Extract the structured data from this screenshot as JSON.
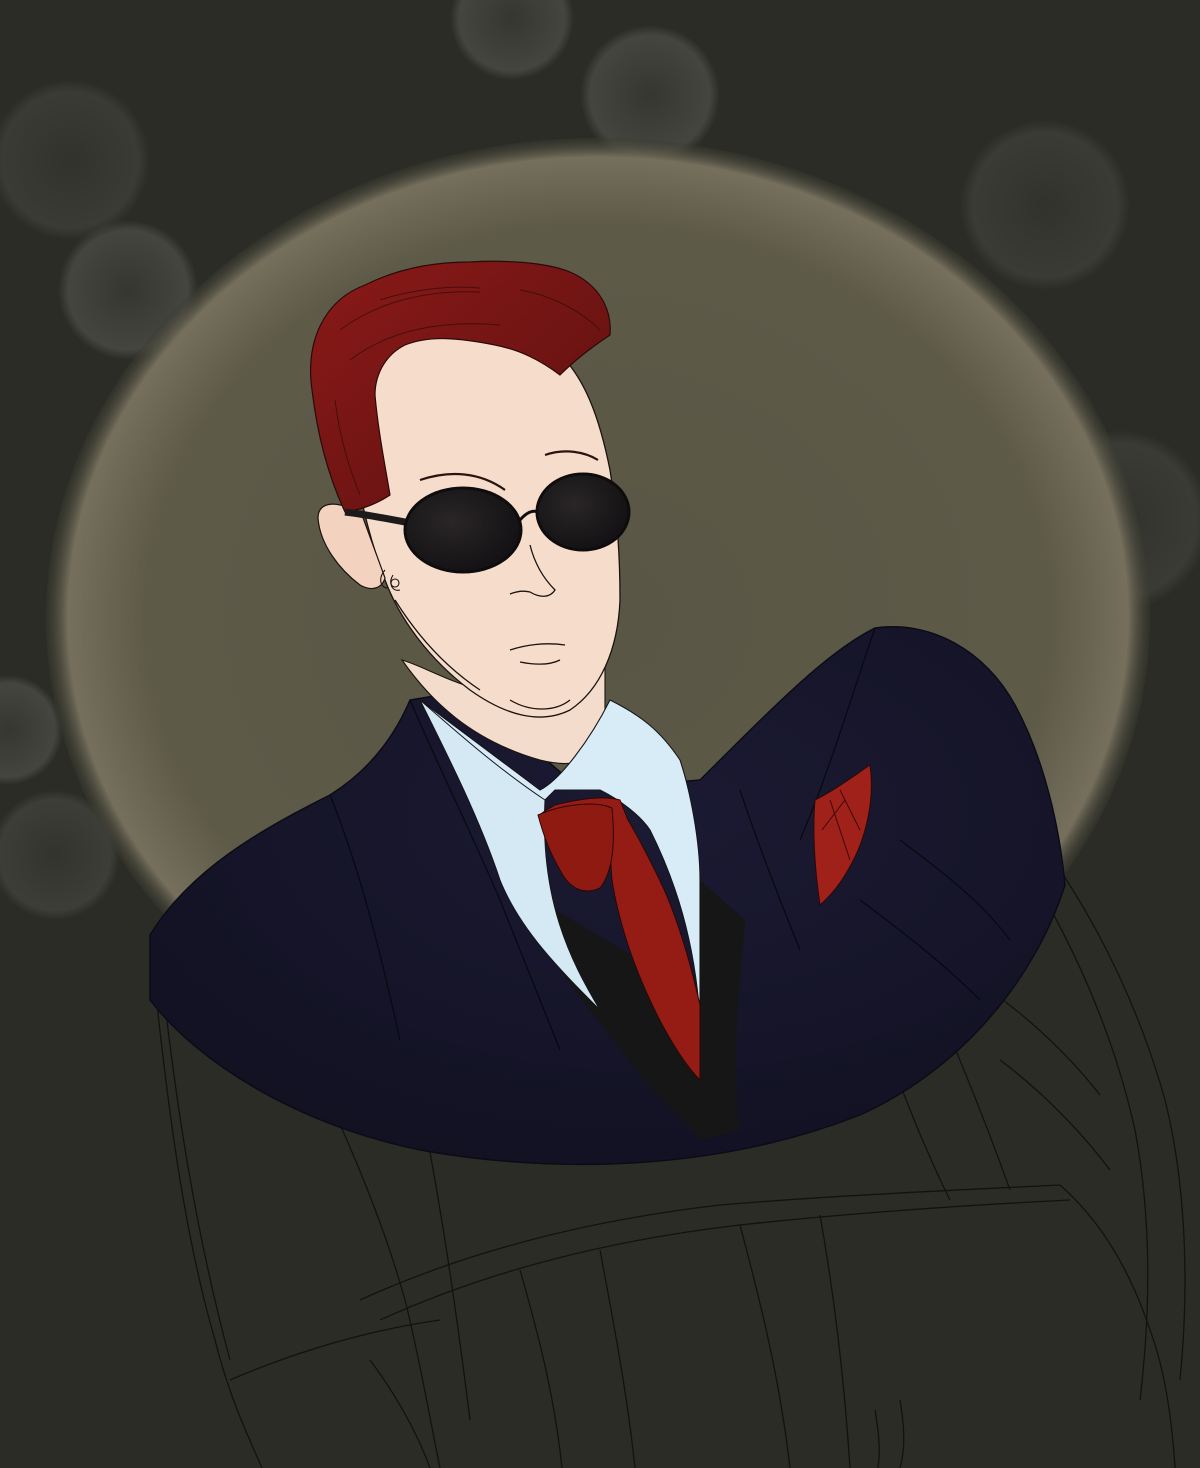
{
  "artwork": {
    "subject": "portrait-illustration",
    "colors": {
      "background": "#2b2c26",
      "spotlight": "#5e5a48",
      "spotlight_edge": "#8a8470",
      "hair": "#7a1616",
      "skin": "#f6dccb",
      "sunglasses": "#1d1a1c",
      "suit": "#161428",
      "shirt": "#d8ecf7",
      "tie": "#941c14",
      "pocket_square": "#a0201a",
      "waistcoat": "#161616",
      "sketch_line": "#0d0d0d"
    },
    "elements": [
      "bokeh-lights",
      "spotlight",
      "hair",
      "face",
      "ear",
      "earring",
      "sunglasses",
      "neck",
      "shirt-collar",
      "tie",
      "waistcoat",
      "suit-jacket",
      "pocket-square",
      "sketched-arms"
    ]
  }
}
